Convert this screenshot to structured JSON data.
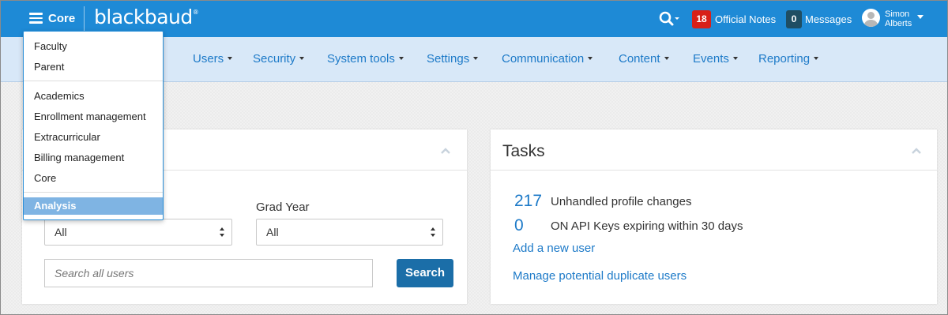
{
  "topbar": {
    "core_label": "Core",
    "brand": "blackbaud",
    "brand_mark": "®",
    "official_notes_count": "18",
    "official_notes_label": "Official Notes",
    "messages_count": "0",
    "messages_label": "Messages",
    "user_first": "Simon",
    "user_last": "Alberts"
  },
  "nav": {
    "items": [
      "Users",
      "Security",
      "System tools",
      "Settings",
      "Communication",
      "Content",
      "Events",
      "Reporting"
    ]
  },
  "dropdown": {
    "group1": [
      "Faculty",
      "Parent"
    ],
    "group2": [
      "Academics",
      "Enrollment management",
      "Extracurricular",
      "Billing management",
      "Core"
    ],
    "active": "Analysis"
  },
  "search_panel": {
    "grad_year_label": "Grad Year",
    "select1_value": "All",
    "select2_value": "All",
    "search_placeholder": "Search all users",
    "search_button": "Search"
  },
  "tasks_panel": {
    "title": "Tasks",
    "stats": [
      {
        "value": "217",
        "label": "Unhandled profile changes"
      },
      {
        "value": "0",
        "label": "ON API Keys expiring within 30 days"
      }
    ],
    "links": [
      "Add a new user",
      "Manage potential duplicate users"
    ]
  },
  "colors": {
    "topbar": "#1e8ad6",
    "navbar": "#d8e8f8",
    "link": "#1d7ac8",
    "badge_red": "#d82019",
    "badge_dark": "#1f4e63",
    "button": "#1b6ea8"
  }
}
